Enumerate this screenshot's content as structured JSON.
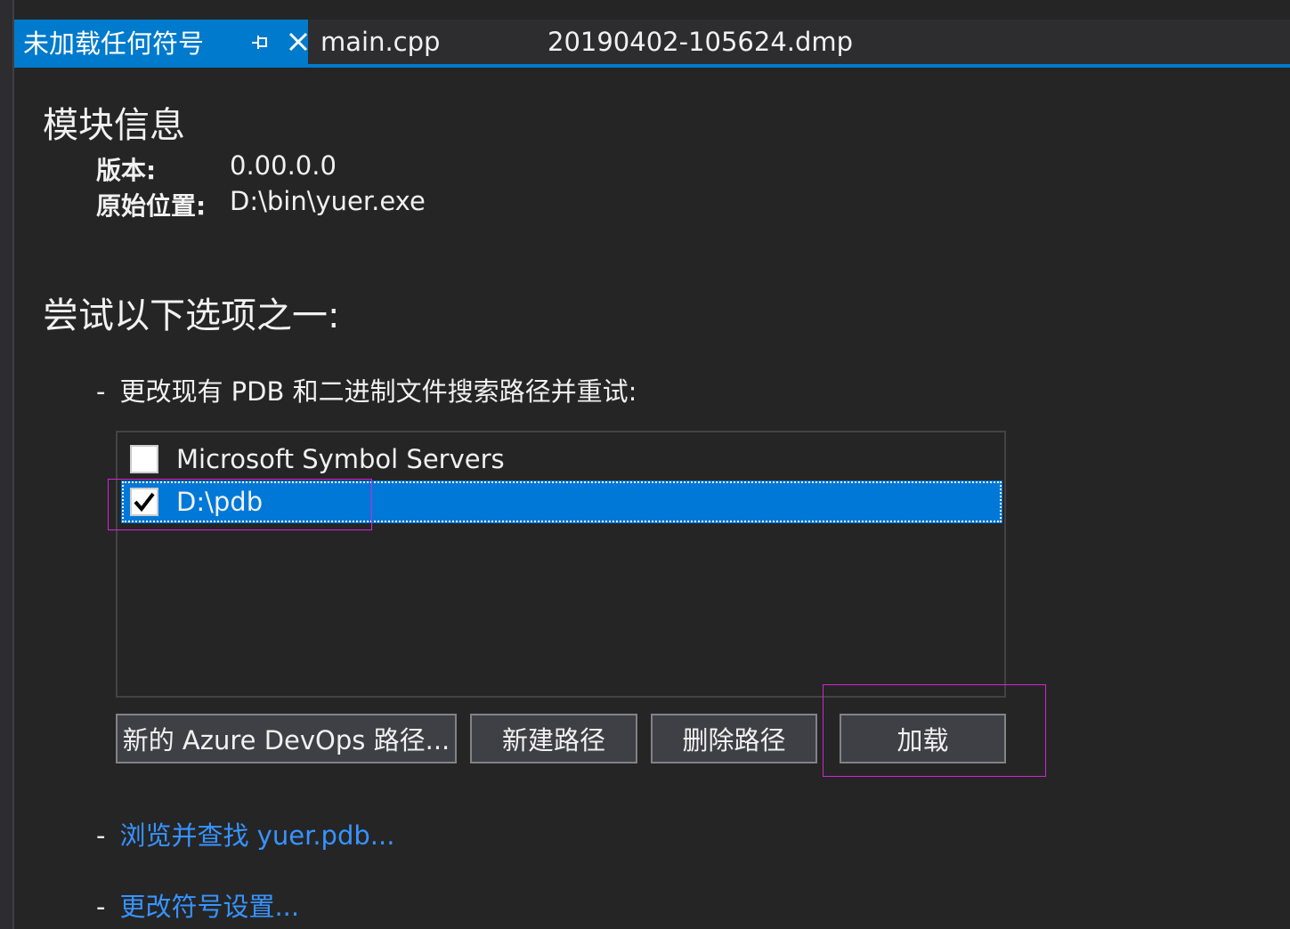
{
  "tabs": [
    {
      "label": "未加载任何符号",
      "active": true
    },
    {
      "label": "main.cpp"
    },
    {
      "label": "20190402-105624.dmp"
    }
  ],
  "module_info": {
    "title": "模块信息",
    "version_label": "版本:",
    "version_value": "0.00.0.0",
    "location_label": "原始位置:",
    "location_value": "D:\\bin\\yuer.exe"
  },
  "options": {
    "title": "尝试以下选项之一:",
    "dash": "-",
    "change_paths_text": "更改现有 PDB 和二进制文件搜索路径并重试:",
    "search_paths": [
      {
        "label": "Microsoft Symbol Servers",
        "checked": false
      },
      {
        "label": "D:\\pdb",
        "checked": true,
        "selected": true
      }
    ],
    "buttons": {
      "new_azure": "新的 Azure DevOps 路径...",
      "new_path": "新建路径",
      "delete_path": "删除路径",
      "load": "加载"
    },
    "browse_link": "浏览并查找 yuer.pdb...",
    "settings_link": "更改符号设置..."
  },
  "colors": {
    "accent": "#007acc",
    "selection": "#0078d7",
    "link": "#3794ff",
    "highlight_box": "#d424d4",
    "background": "#252526"
  }
}
